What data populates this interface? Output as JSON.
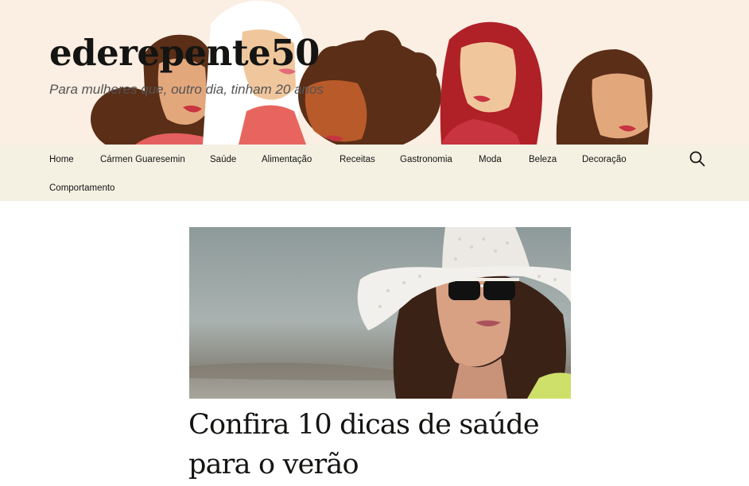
{
  "site": {
    "title": "ederepente50",
    "tagline": "Para mulheres que, outro dia, tinham 20 anos"
  },
  "nav": {
    "items": [
      {
        "label": "Home"
      },
      {
        "label": "Cármen Guaresemin"
      },
      {
        "label": "Saúde"
      },
      {
        "label": "Alimentação"
      },
      {
        "label": "Receitas"
      },
      {
        "label": "Gastronomia"
      },
      {
        "label": "Moda"
      },
      {
        "label": "Beleza"
      },
      {
        "label": "Decoração"
      },
      {
        "label": "Comportamento"
      }
    ],
    "search_icon": "search-icon"
  },
  "post": {
    "title": "Confira 10 dicas de saúde para o verão",
    "image_subject": "woman-in-sun-hat-photo"
  },
  "colors": {
    "header_bg": "#fbeee2",
    "nav_bg": "#f4f1e3",
    "text": "#141412",
    "tagline": "#545454"
  }
}
